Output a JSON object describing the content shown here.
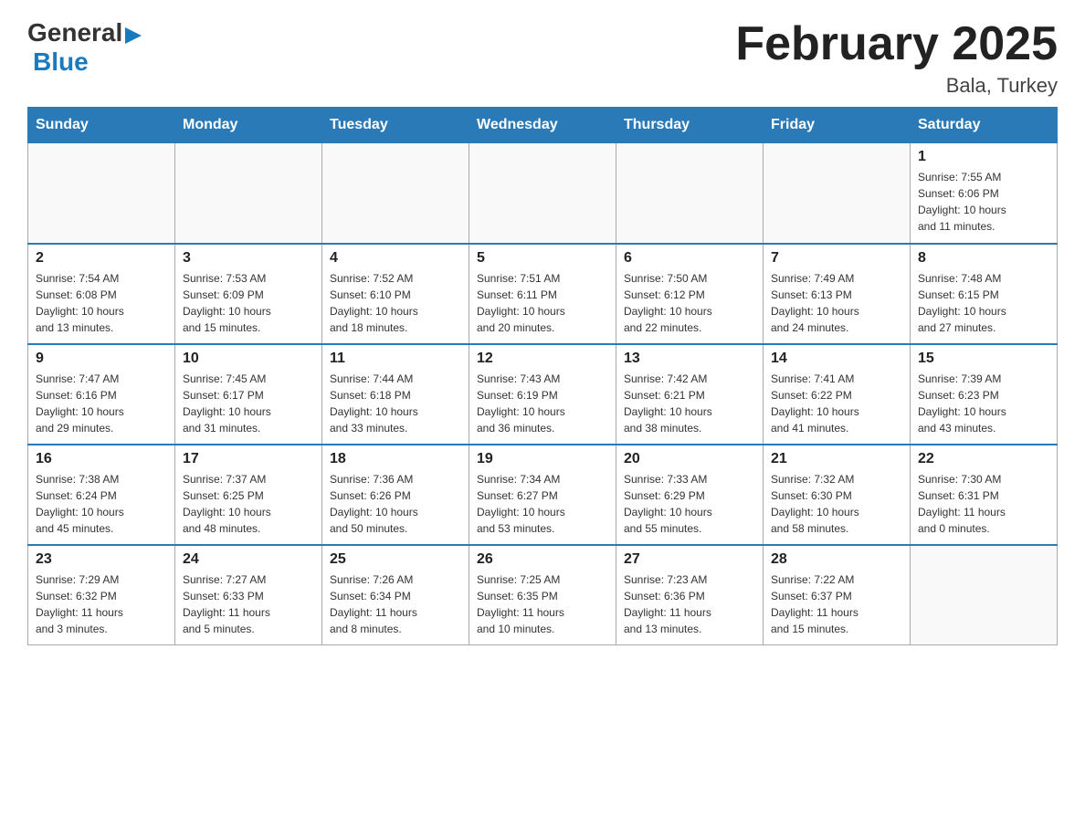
{
  "header": {
    "logo": {
      "general": "General",
      "flag_shape": "▶",
      "blue": "Blue"
    },
    "title": "February 2025",
    "location": "Bala, Turkey"
  },
  "weekdays": [
    "Sunday",
    "Monday",
    "Tuesday",
    "Wednesday",
    "Thursday",
    "Friday",
    "Saturday"
  ],
  "weeks": [
    [
      {
        "day": "",
        "info": ""
      },
      {
        "day": "",
        "info": ""
      },
      {
        "day": "",
        "info": ""
      },
      {
        "day": "",
        "info": ""
      },
      {
        "day": "",
        "info": ""
      },
      {
        "day": "",
        "info": ""
      },
      {
        "day": "1",
        "info": "Sunrise: 7:55 AM\nSunset: 6:06 PM\nDaylight: 10 hours\nand 11 minutes."
      }
    ],
    [
      {
        "day": "2",
        "info": "Sunrise: 7:54 AM\nSunset: 6:08 PM\nDaylight: 10 hours\nand 13 minutes."
      },
      {
        "day": "3",
        "info": "Sunrise: 7:53 AM\nSunset: 6:09 PM\nDaylight: 10 hours\nand 15 minutes."
      },
      {
        "day": "4",
        "info": "Sunrise: 7:52 AM\nSunset: 6:10 PM\nDaylight: 10 hours\nand 18 minutes."
      },
      {
        "day": "5",
        "info": "Sunrise: 7:51 AM\nSunset: 6:11 PM\nDaylight: 10 hours\nand 20 minutes."
      },
      {
        "day": "6",
        "info": "Sunrise: 7:50 AM\nSunset: 6:12 PM\nDaylight: 10 hours\nand 22 minutes."
      },
      {
        "day": "7",
        "info": "Sunrise: 7:49 AM\nSunset: 6:13 PM\nDaylight: 10 hours\nand 24 minutes."
      },
      {
        "day": "8",
        "info": "Sunrise: 7:48 AM\nSunset: 6:15 PM\nDaylight: 10 hours\nand 27 minutes."
      }
    ],
    [
      {
        "day": "9",
        "info": "Sunrise: 7:47 AM\nSunset: 6:16 PM\nDaylight: 10 hours\nand 29 minutes."
      },
      {
        "day": "10",
        "info": "Sunrise: 7:45 AM\nSunset: 6:17 PM\nDaylight: 10 hours\nand 31 minutes."
      },
      {
        "day": "11",
        "info": "Sunrise: 7:44 AM\nSunset: 6:18 PM\nDaylight: 10 hours\nand 33 minutes."
      },
      {
        "day": "12",
        "info": "Sunrise: 7:43 AM\nSunset: 6:19 PM\nDaylight: 10 hours\nand 36 minutes."
      },
      {
        "day": "13",
        "info": "Sunrise: 7:42 AM\nSunset: 6:21 PM\nDaylight: 10 hours\nand 38 minutes."
      },
      {
        "day": "14",
        "info": "Sunrise: 7:41 AM\nSunset: 6:22 PM\nDaylight: 10 hours\nand 41 minutes."
      },
      {
        "day": "15",
        "info": "Sunrise: 7:39 AM\nSunset: 6:23 PM\nDaylight: 10 hours\nand 43 minutes."
      }
    ],
    [
      {
        "day": "16",
        "info": "Sunrise: 7:38 AM\nSunset: 6:24 PM\nDaylight: 10 hours\nand 45 minutes."
      },
      {
        "day": "17",
        "info": "Sunrise: 7:37 AM\nSunset: 6:25 PM\nDaylight: 10 hours\nand 48 minutes."
      },
      {
        "day": "18",
        "info": "Sunrise: 7:36 AM\nSunset: 6:26 PM\nDaylight: 10 hours\nand 50 minutes."
      },
      {
        "day": "19",
        "info": "Sunrise: 7:34 AM\nSunset: 6:27 PM\nDaylight: 10 hours\nand 53 minutes."
      },
      {
        "day": "20",
        "info": "Sunrise: 7:33 AM\nSunset: 6:29 PM\nDaylight: 10 hours\nand 55 minutes."
      },
      {
        "day": "21",
        "info": "Sunrise: 7:32 AM\nSunset: 6:30 PM\nDaylight: 10 hours\nand 58 minutes."
      },
      {
        "day": "22",
        "info": "Sunrise: 7:30 AM\nSunset: 6:31 PM\nDaylight: 11 hours\nand 0 minutes."
      }
    ],
    [
      {
        "day": "23",
        "info": "Sunrise: 7:29 AM\nSunset: 6:32 PM\nDaylight: 11 hours\nand 3 minutes."
      },
      {
        "day": "24",
        "info": "Sunrise: 7:27 AM\nSunset: 6:33 PM\nDaylight: 11 hours\nand 5 minutes."
      },
      {
        "day": "25",
        "info": "Sunrise: 7:26 AM\nSunset: 6:34 PM\nDaylight: 11 hours\nand 8 minutes."
      },
      {
        "day": "26",
        "info": "Sunrise: 7:25 AM\nSunset: 6:35 PM\nDaylight: 11 hours\nand 10 minutes."
      },
      {
        "day": "27",
        "info": "Sunrise: 7:23 AM\nSunset: 6:36 PM\nDaylight: 11 hours\nand 13 minutes."
      },
      {
        "day": "28",
        "info": "Sunrise: 7:22 AM\nSunset: 6:37 PM\nDaylight: 11 hours\nand 15 minutes."
      },
      {
        "day": "",
        "info": ""
      }
    ]
  ]
}
